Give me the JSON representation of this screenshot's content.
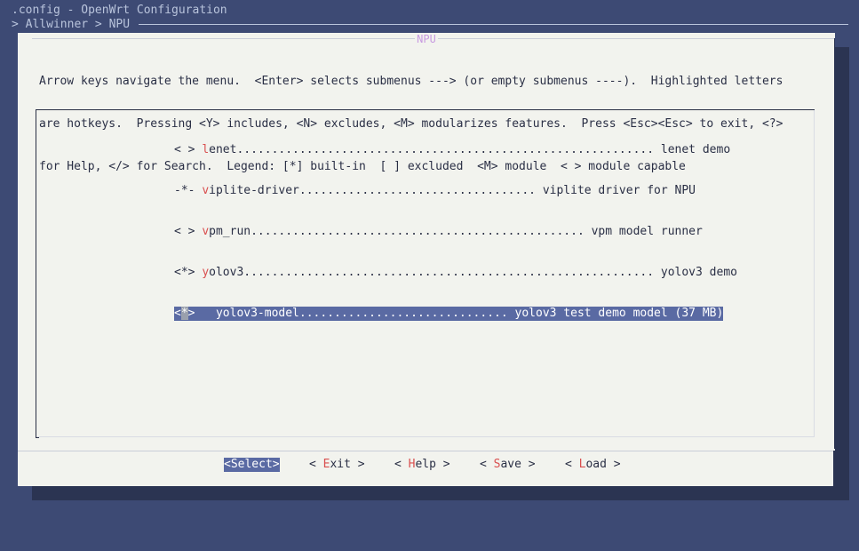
{
  "header": {
    "title": ".config - OpenWrt Configuration",
    "breadcrumb": "> Allwinner > NPU"
  },
  "dialog": {
    "title": "NPU",
    "help_lines": [
      "Arrow keys navigate the menu.  <Enter> selects submenus ---> (or empty submenus ----).  Highlighted letters",
      "are hotkeys.  Pressing <Y> includes, <N> excludes, <M> modularizes features.  Press <Esc><Esc> to exit, <?>",
      "for Help, </> for Search.  Legend: [*] built-in  [ ] excluded  <M> module  < > module capable"
    ]
  },
  "menu": {
    "items": [
      {
        "prefix": "< > ",
        "hot": "l",
        "rest": "enet............................................................ lenet demo"
      },
      {
        "prefix": "-*- ",
        "hot": "v",
        "rest": "iplite-driver.................................. viplite driver for NPU"
      },
      {
        "prefix": "< > ",
        "hot": "v",
        "rest": "pm_run................................................ vpm model runner"
      },
      {
        "prefix": "<*> ",
        "hot": "y",
        "rest": "olov3........................................................... yolov3 demo"
      },
      {
        "prefix_open": "<",
        "cursor": "*",
        "prefix_close": ">",
        "text": "   yolov3-model.............................. yolov3 test demo model (37 MB)"
      }
    ]
  },
  "buttons": {
    "select": "<Select>",
    "exit": {
      "left": "< ",
      "hot": "E",
      "rest": "xit >"
    },
    "help": {
      "left": "< ",
      "hot": "H",
      "rest": "elp >"
    },
    "save": {
      "left": "< ",
      "hot": "S",
      "rest": "ave >"
    },
    "load": {
      "left": "< ",
      "hot": "L",
      "rest": "oad >"
    }
  }
}
